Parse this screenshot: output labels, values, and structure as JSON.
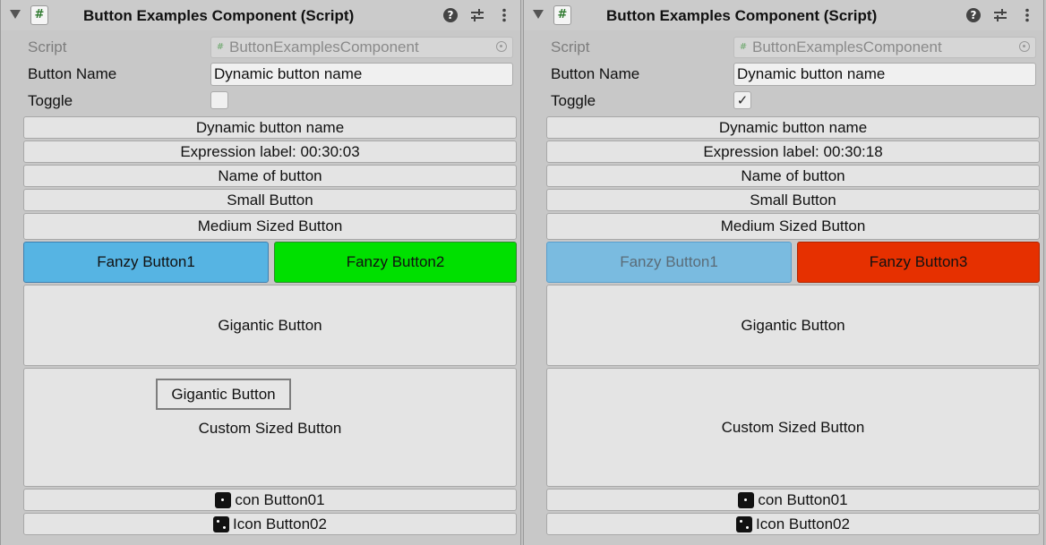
{
  "colors": {
    "fancy_blue": "#56b4e3",
    "fancy_blue_faded": "#7abbe0",
    "fancy_green": "#00e000",
    "fancy_red": "#e63000"
  },
  "icons": [
    "foldout-arrow-icon",
    "script-hash-icon",
    "help-icon",
    "sliders-icon",
    "kebab-menu-icon",
    "object-picker-icon",
    "die-one-icon",
    "die-two-icon",
    "checkmark-icon"
  ],
  "panels": [
    {
      "header": {
        "badge": "#",
        "title": "Button Examples Component (Script)",
        "help": "?"
      },
      "fields": {
        "script_label": "Script",
        "script_hash": "#",
        "script_value": "ButtonExamplesComponent",
        "button_name_label": "Button Name",
        "button_name_value": "Dynamic button name",
        "toggle_label": "Toggle",
        "toggle_mark": ""
      },
      "buttons": {
        "dynamic": "Dynamic button name",
        "expression": "Expression label: 00:30:03",
        "name_of": "Name of button",
        "small": "Small Button",
        "medium": "Medium Sized Button",
        "fancy_a": "Fanzy Button1",
        "fancy_b": "Fanzy Button2",
        "gigantic": "Gigantic Button",
        "custom_inner": "Gigantic Button",
        "custom": "Custom Sized Button",
        "icon1": "con Button01",
        "icon2": "Icon Button02"
      }
    },
    {
      "header": {
        "badge": "#",
        "title": "Button Examples Component (Script)",
        "help": "?"
      },
      "fields": {
        "script_label": "Script",
        "script_hash": "#",
        "script_value": "ButtonExamplesComponent",
        "button_name_label": "Button Name",
        "button_name_value": "Dynamic button name",
        "toggle_label": "Toggle",
        "toggle_mark": "✓"
      },
      "buttons": {
        "dynamic": "Dynamic button name",
        "expression": "Expression label: 00:30:18",
        "name_of": "Name of button",
        "small": "Small Button",
        "medium": "Medium Sized Button",
        "fancy_a": "Fanzy Button1",
        "fancy_b": "Fanzy Button3",
        "gigantic": "Gigantic Button",
        "custom": "Custom Sized Button",
        "icon1": "con Button01",
        "icon2": "Icon Button02"
      }
    }
  ]
}
